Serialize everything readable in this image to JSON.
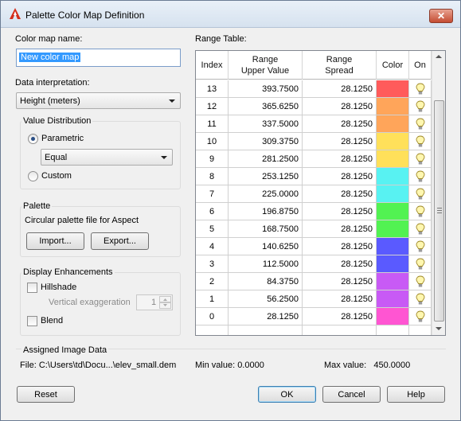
{
  "window": {
    "title": "Palette Color Map Definition",
    "close_glyph": "✕",
    "app_icon": "autocad-a-icon"
  },
  "color_map_name": {
    "label": "Color map name:",
    "value": "New color map"
  },
  "data_interpretation": {
    "label": "Data interpretation:",
    "selected": "Height (meters)"
  },
  "value_distribution": {
    "title": "Value Distribution",
    "parametric_label": "Parametric",
    "parametric_checked": true,
    "method_selected": "Equal",
    "custom_label": "Custom",
    "custom_checked": false
  },
  "palette": {
    "title": "Palette",
    "description": "Circular palette file for Aspect",
    "import_label": "Import...",
    "export_label": "Export..."
  },
  "display_enhancements": {
    "title": "Display Enhancements",
    "hillshade_label": "Hillshade",
    "hillshade_checked": false,
    "vertical_exaggeration_label": "Vertical exaggeration",
    "vertical_exaggeration_value": "1",
    "blend_label": "Blend",
    "blend_checked": false
  },
  "range_table": {
    "label": "Range Table:",
    "columns": {
      "index": "Index",
      "upper_line1": "Range",
      "upper_line2": "Upper Value",
      "spread_line1": "Range",
      "spread_line2": "Spread",
      "color": "Color",
      "on": "On"
    },
    "rows": [
      {
        "index": "13",
        "upper": "393.7500",
        "spread": "28.1250",
        "color": "#ff5b5b",
        "on": true
      },
      {
        "index": "12",
        "upper": "365.6250",
        "spread": "28.1250",
        "color": "#ffa55a",
        "on": true
      },
      {
        "index": "11",
        "upper": "337.5000",
        "spread": "28.1250",
        "color": "#ffa55a",
        "on": true
      },
      {
        "index": "10",
        "upper": "309.3750",
        "spread": "28.1250",
        "color": "#ffe05a",
        "on": true
      },
      {
        "index": "9",
        "upper": "281.2500",
        "spread": "28.1250",
        "color": "#ffe05a",
        "on": true
      },
      {
        "index": "8",
        "upper": "253.1250",
        "spread": "28.1250",
        "color": "#58f2f2",
        "on": true
      },
      {
        "index": "7",
        "upper": "225.0000",
        "spread": "28.1250",
        "color": "#58f2f2",
        "on": true
      },
      {
        "index": "6",
        "upper": "196.8750",
        "spread": "28.1250",
        "color": "#52f252",
        "on": true
      },
      {
        "index": "5",
        "upper": "168.7500",
        "spread": "28.1250",
        "color": "#52f252",
        "on": true
      },
      {
        "index": "4",
        "upper": "140.6250",
        "spread": "28.1250",
        "color": "#5a5aff",
        "on": true
      },
      {
        "index": "3",
        "upper": "112.5000",
        "spread": "28.1250",
        "color": "#5a5aff",
        "on": true
      },
      {
        "index": "2",
        "upper": "84.3750",
        "spread": "28.1250",
        "color": "#c85af5",
        "on": true
      },
      {
        "index": "1",
        "upper": "56.2500",
        "spread": "28.1250",
        "color": "#c85af5",
        "on": true
      },
      {
        "index": "0",
        "upper": "28.1250",
        "spread": "28.1250",
        "color": "#ff55d2",
        "on": true
      }
    ]
  },
  "assigned_image_data": {
    "title": "Assigned Image Data",
    "file": "File: C:\\Users\\td\\Docu...\\elev_small.dem",
    "min_value": "Min value: 0.0000",
    "max_value": "Max value:   450.0000"
  },
  "buttons": {
    "reset": "Reset",
    "ok": "OK",
    "cancel": "Cancel",
    "help": "Help"
  },
  "icons": {
    "bulb": "lightbulb-icon",
    "scroll_up": "scroll-up-icon",
    "scroll_down": "scroll-down-icon"
  }
}
